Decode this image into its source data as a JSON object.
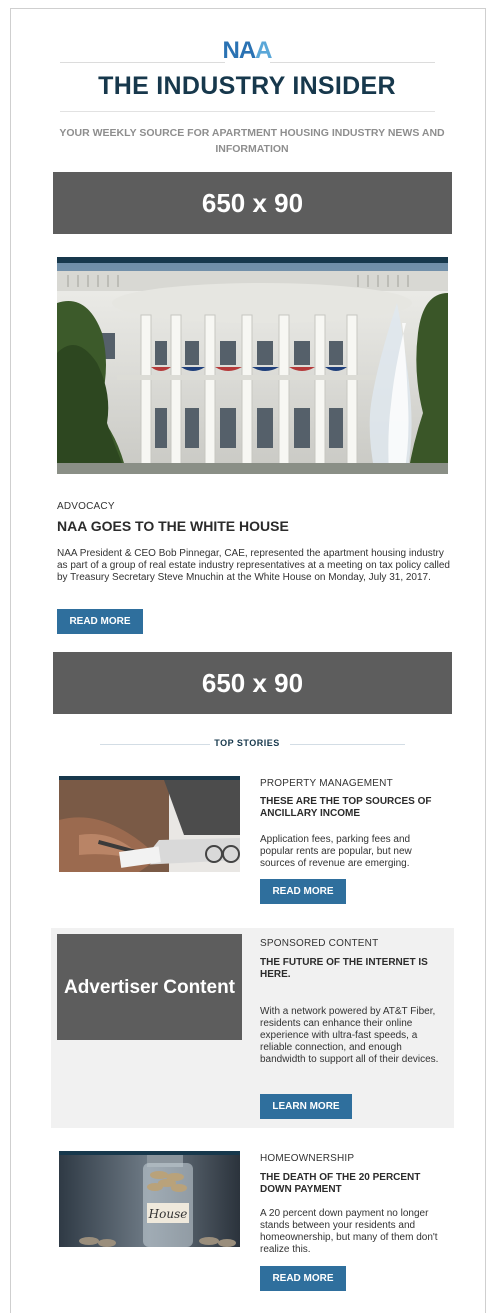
{
  "header": {
    "logo_left": "NA",
    "logo_mid": "A",
    "title": "THE INDUSTRY INSIDER",
    "tagline": "YOUR WEEKLY SOURCE FOR APARTMENT HOUSING INDUSTRY NEWS AND INFORMATION"
  },
  "ads": {
    "top": "650 x 90",
    "middle": "650 x 90"
  },
  "feature": {
    "category": "ADVOCACY",
    "headline": "NAA GOES TO THE WHITE HOUSE",
    "body": "NAA President & CEO Bob Pinnegar, CAE, represented the apartment housing industry as part of a group of real estate industry representatives at a meeting on tax policy called by Treasury Secretary Steve Mnuchin at the White House on Monday, July 31, 2017.",
    "button": "READ MORE"
  },
  "top_stories": {
    "label": "TOP STORIES",
    "items": [
      {
        "category": "PROPERTY MANAGEMENT",
        "headline": "THESE ARE THE TOP SOURCES OF ANCILLARY INCOME",
        "body": "Application fees, parking fees and popular rents are popular, but new sources of revenue are emerging.",
        "button": "READ MORE"
      },
      {
        "category": "SPONSORED CONTENT",
        "headline": "THE FUTURE OF THE INTERNET IS HERE.",
        "body": "With a network powered by AT&T Fiber, residents can enhance their online experience with ultra-fast speeds, a reliable connection, and enough bandwidth to support all of their devices.",
        "button": "LEARN MORE",
        "advertiser": "Advertiser Content"
      },
      {
        "category": "HOMEOWNERSHIP",
        "headline": "THE DEATH OF THE 20 PERCENT DOWN PAYMENT",
        "body": "A 20 percent down payment no longer stands between your residents and homeownership, but many of them don't realize this.",
        "button": "READ MORE",
        "jar_label": "House"
      }
    ]
  }
}
